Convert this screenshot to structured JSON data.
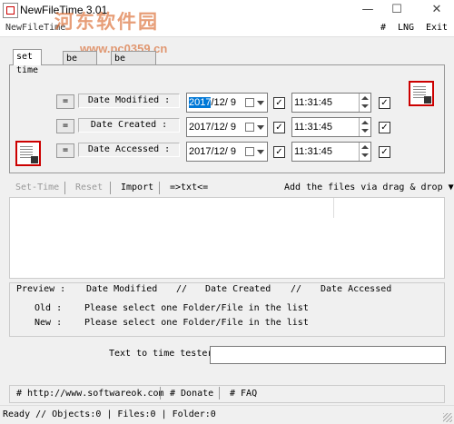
{
  "window": {
    "title": "NewFileTime 3.01",
    "minimize_glyph": "—",
    "maximize_glyph": "☐",
    "close_glyph": "✕"
  },
  "watermark": {
    "site_name": "河东软件园",
    "url": "www.pc0359.cn"
  },
  "menu": {
    "hotkey": "#",
    "lng": "LNG",
    "exit": "Exit",
    "window_caption": "NewFileTime"
  },
  "tabs": [
    {
      "label": "set time"
    },
    {
      "label": "be older"
    },
    {
      "label": "be younger"
    }
  ],
  "rows": [
    {
      "eq": "=",
      "label": "Date Modified :",
      "date_selected": "2017",
      "date_rest": "/12/  9",
      "time": "11:31:45",
      "date_checked": true,
      "time_checked": true
    },
    {
      "eq": "=",
      "label": "Date Created :",
      "date_selected": "",
      "date_rest": "2017/12/  9",
      "time": "11:31:45",
      "date_checked": true,
      "time_checked": true
    },
    {
      "eq": "=",
      "label": "Date Accessed :",
      "date_selected": "",
      "date_rest": "2017/12/  9",
      "time": "11:31:45",
      "date_checked": true,
      "time_checked": true
    }
  ],
  "check_glyph": "✓",
  "toolbar": {
    "set_time": "Set-Time",
    "reset": "Reset",
    "import": "Import",
    "txt": "=>txt<=",
    "add_files": "Add the files via drag & drop",
    "add_files_arrow": "▼"
  },
  "preview": {
    "header_preview": "Preview  :",
    "header_modified": "Date Modified",
    "sep1": "//",
    "header_created": "Date Created",
    "sep2": "//",
    "header_accessed": "Date Accessed",
    "old_label": "Old :",
    "new_label": "New :",
    "old_message": "Please select one Folder/File in the list",
    "new_message": "Please select one Folder/File in the list"
  },
  "tester": {
    "label": "Text to time tester",
    "value": ""
  },
  "links": {
    "site": "# http://www.softwareok.com",
    "donate": "# Donate",
    "faq": "# FAQ"
  },
  "status": {
    "text": "Ready // Objects:0 | Files:0  | Folder:0"
  },
  "colors": {
    "selection": "#0078d7",
    "watermark": "#d4500a"
  }
}
